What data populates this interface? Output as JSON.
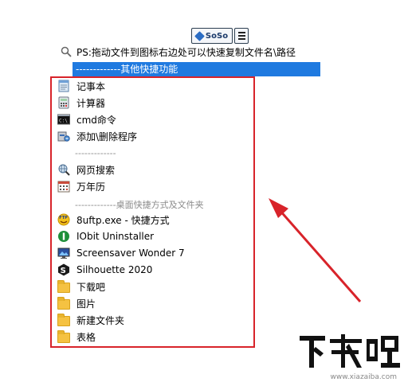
{
  "toolbar": {
    "logo_text": "SoSo"
  },
  "search": {
    "text": "PS:拖动文件到图标右边处可以快速复制文件名\\路径"
  },
  "selected": {
    "text": "-------------其他快捷功能"
  },
  "items": [
    {
      "label": "记事本",
      "icon": "notepad-icon"
    },
    {
      "label": "计算器",
      "icon": "calculator-icon"
    },
    {
      "label": "cmd命令",
      "icon": "cmd-icon"
    },
    {
      "label": "添加\\删除程序",
      "icon": "add-remove-programs-icon"
    },
    {
      "label": "网页搜索",
      "icon": "web-search-icon"
    },
    {
      "label": "万年历",
      "icon": "calendar-icon"
    },
    {
      "label": "8uftp.exe - 快捷方式",
      "icon": "ftp-icon"
    },
    {
      "label": "IObit Uninstaller",
      "icon": "iobit-uninstaller-icon"
    },
    {
      "label": "Screensaver Wonder 7",
      "icon": "screensaver-icon"
    },
    {
      "label": "Silhouette 2020",
      "icon": "silhouette-icon"
    },
    {
      "label": "下载吧",
      "icon": "folder-icon"
    },
    {
      "label": "图片",
      "icon": "folder-icon"
    },
    {
      "label": "新建文件夹",
      "icon": "folder-icon"
    },
    {
      "label": "表格",
      "icon": "folder-icon"
    }
  ],
  "separators": {
    "first": "-------------",
    "desktop": "-------------桌面快捷方式及文件夹"
  },
  "watermark": {
    "logo_text": "下载吧",
    "url": "www.xiazaiba.com"
  },
  "colors": {
    "selection": "#1f7ae0",
    "highlight_border": "#d8232a",
    "arrow": "#d8232a"
  }
}
